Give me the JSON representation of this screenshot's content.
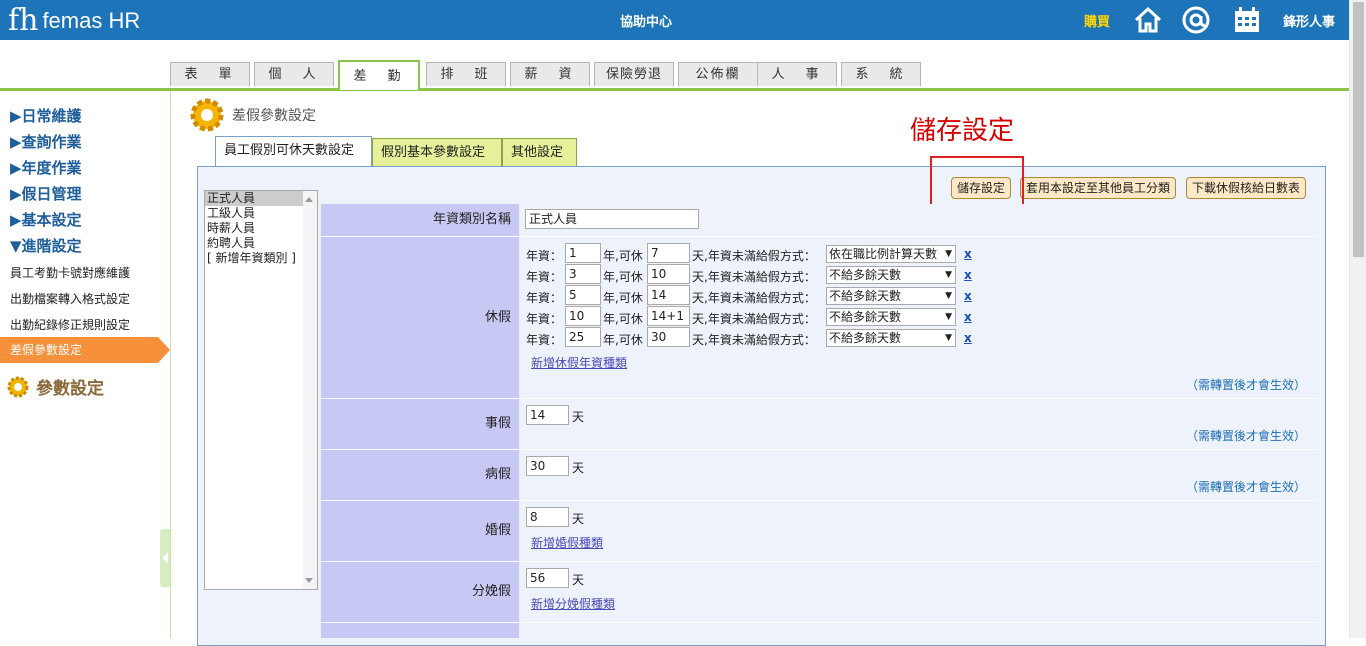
{
  "header": {
    "logo_mark": "fh",
    "logo_text": "femas HR",
    "center_title": "協助中心",
    "buy_label": "購買",
    "company": "鋒形人事",
    "icons": [
      "home-icon",
      "at-icon",
      "calendar-icon"
    ]
  },
  "main_tabs": [
    "表　單",
    "個　人",
    "差　勤",
    "排　班",
    "薪　資",
    "保險勞退",
    "公佈欄",
    "人　事",
    "系　統"
  ],
  "sidebar": {
    "sections": [
      "▶日常維護",
      "▶查詢作業",
      "▶年度作業",
      "▶假日管理",
      "▶基本設定",
      "▼進階設定"
    ],
    "sub_items": [
      "員工考勤卡號對應維護",
      "出勤檔案轉入格式設定",
      "出勤紀錄修正規則設定",
      "差假參數設定"
    ],
    "param_label": "參數設定"
  },
  "page": {
    "heading": "差假參數設定",
    "annotation": "儲存設定",
    "sub_tabs": [
      "員工假別可休天數設定",
      "假別基本參數設定",
      "其他設定"
    ],
    "buttons": {
      "save": "儲存設定",
      "apply": "套用本設定至其他員工分類",
      "download": "下載休假核給日數表"
    },
    "type_list": [
      "正式人員",
      "工級人員",
      "時薪人員",
      "約聘人員",
      "[ 新增年資類別 ]"
    ],
    "rows": {
      "name_label": "年資類別名稱",
      "name_value": "正式人員",
      "annual_label": "休假",
      "annual_tiers": [
        {
          "years": "1",
          "days": "7",
          "method": "依在職比例計算天數"
        },
        {
          "years": "3",
          "days": "10",
          "method": "不給多餘天數"
        },
        {
          "years": "5",
          "days": "14",
          "method": "不給多餘天數"
        },
        {
          "years": "10",
          "days": "14+1",
          "method": "不給多餘天數"
        },
        {
          "years": "25",
          "days": "30",
          "method": "不給多餘天數"
        }
      ],
      "tier_text": {
        "years_prefix": "年資：",
        "years_suffix": "年,可休",
        "days_suffix": "天,年資未滿給假方式：",
        "delete": "x"
      },
      "add_annual_link": "新增休假年資種類",
      "note": "（需轉置後才會生效）",
      "personal_label": "事假",
      "personal_days": "14",
      "sick_label": "病假",
      "sick_days": "30",
      "marriage_label": "婚假",
      "marriage_days": "8",
      "add_marriage_link": "新增婚假種類",
      "maternity_label": "分娩假",
      "maternity_days": "56",
      "add_maternity_link": "新增分娩假種類",
      "day_unit": "天"
    }
  }
}
